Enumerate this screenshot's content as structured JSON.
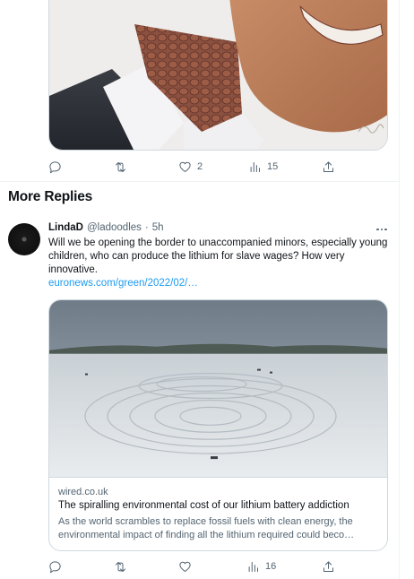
{
  "previous_tweet": {
    "actions": {
      "reply_count": "",
      "retweet_count": "",
      "like_count": "2",
      "views_count": "15"
    }
  },
  "section": {
    "title": "More Replies"
  },
  "reply": {
    "display_name": "LindaD",
    "handle": "@ladoodles",
    "separator": "·",
    "time": "5h",
    "text": "Will we be opening the border to unaccompanied minors, especially young children, who can produce the lithium for slave wages? How very innovative.",
    "link_text": "euronews.com/green/2022/02/…",
    "card": {
      "domain": "wired.co.uk",
      "title": "The spiralling environmental cost of our lithium battery addiction",
      "description_line1": "As the world scrambles to replace fossil fuels with clean energy, the",
      "description_line2": "environmental impact of finding all the lithium required could beco…"
    },
    "actions": {
      "reply_count": "",
      "retweet_count": "",
      "like_count": "",
      "views_count": "16"
    }
  },
  "icons": {
    "reply": "reply-icon",
    "retweet": "retweet-icon",
    "like": "heart-icon",
    "views": "views-icon",
    "share": "share-icon",
    "more": "more-icon"
  },
  "colors": {
    "link": "#1d9bf0",
    "text_secondary": "#536471",
    "border": "#cfd9de"
  }
}
